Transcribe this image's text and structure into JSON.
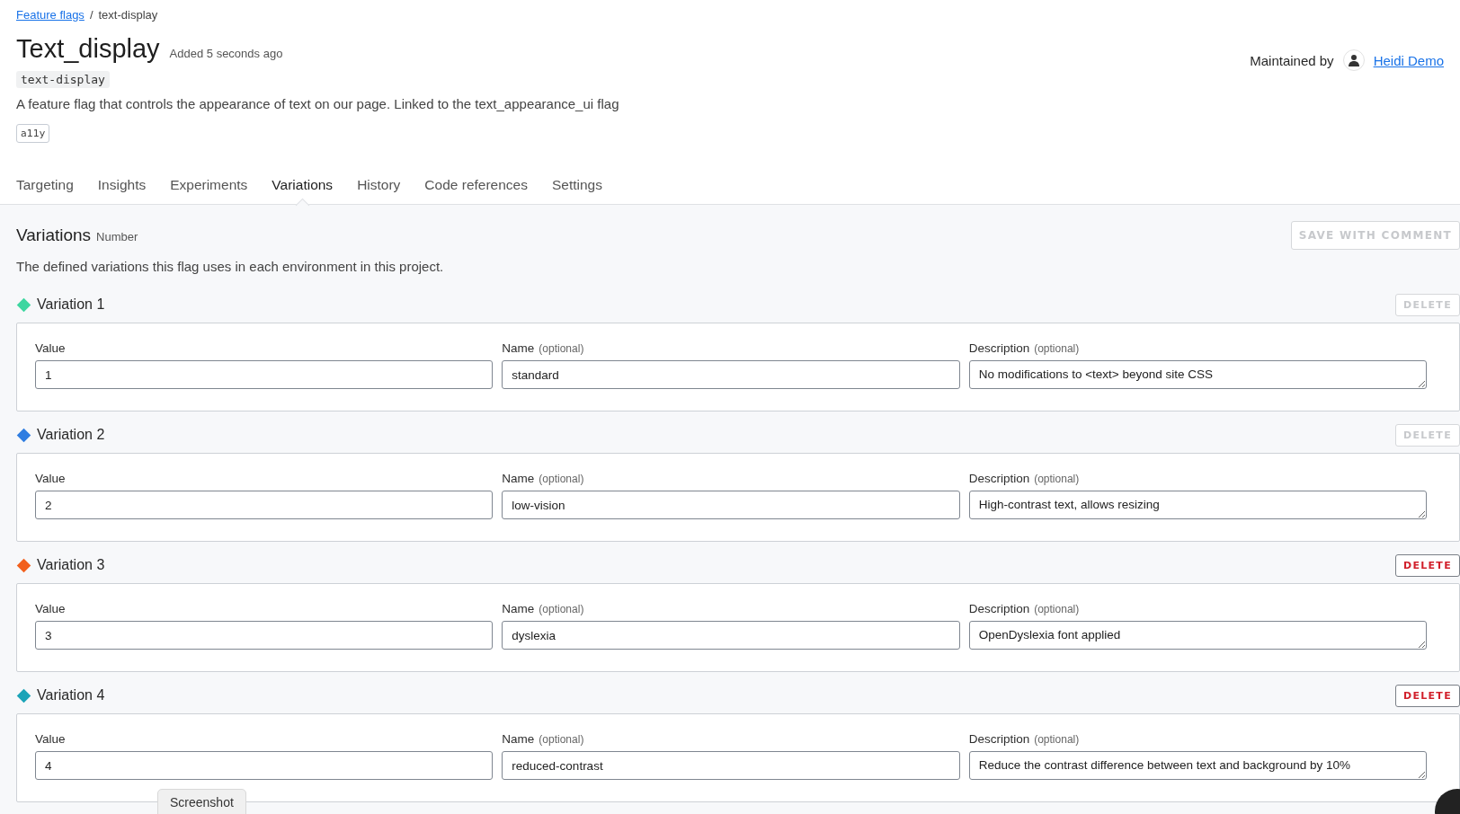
{
  "breadcrumb": {
    "link": "Feature flags",
    "separator": "/",
    "current": "text-display"
  },
  "flag": {
    "title": "Text_display",
    "added": "Added 5 seconds ago",
    "key": "text-display",
    "description": "A feature flag that controls the appearance of text on our page. Linked to the text_appearance_ui flag",
    "tags": [
      "a11y"
    ]
  },
  "maintainer": {
    "label": "Maintained by",
    "name": "Heidi Demo"
  },
  "tabs": [
    {
      "label": "Targeting",
      "selected": false
    },
    {
      "label": "Insights",
      "selected": false
    },
    {
      "label": "Experiments",
      "selected": false
    },
    {
      "label": "Variations",
      "selected": true
    },
    {
      "label": "History",
      "selected": false
    },
    {
      "label": "Code references",
      "selected": false
    },
    {
      "label": "Settings",
      "selected": false
    }
  ],
  "section": {
    "title": "Variations",
    "type": "Number",
    "description": "The defined variations this flag uses in each environment in this project.",
    "save_button": {
      "label": "SAVE WITH COMMENT",
      "disabled": true
    }
  },
  "variations": [
    {
      "title": "Variation 1",
      "color": "#3dd6a0",
      "delete": {
        "label": "DELETE",
        "disabled": true
      },
      "fields": [
        {
          "kind": "input",
          "label": "Value",
          "value": "1"
        },
        {
          "kind": "input",
          "label": "Name",
          "hint": "(optional)",
          "value": "standard"
        },
        {
          "kind": "textarea",
          "label": "Description",
          "hint": "(optional)",
          "value": "No modifications to <text> beyond site CSS"
        }
      ]
    },
    {
      "title": "Variation 2",
      "color": "#2f7de1",
      "delete": {
        "label": "DELETE",
        "disabled": true
      },
      "fields": [
        {
          "kind": "input",
          "label": "Value",
          "value": "2"
        },
        {
          "kind": "input",
          "label": "Name",
          "hint": "(optional)",
          "value": "low-vision"
        },
        {
          "kind": "textarea",
          "label": "Description",
          "hint": "(optional)",
          "value": "High-contrast text, allows resizing"
        }
      ]
    },
    {
      "title": "Variation 3",
      "color": "#f2601d",
      "delete": {
        "label": "DELETE",
        "disabled": false
      },
      "fields": [
        {
          "kind": "input",
          "label": "Value",
          "value": "3"
        },
        {
          "kind": "input",
          "label": "Name",
          "hint": "(optional)",
          "value": "dyslexia"
        },
        {
          "kind": "textarea",
          "label": "Description",
          "hint": "(optional)",
          "value": "OpenDyslexia font applied"
        }
      ]
    },
    {
      "title": "Variation 4",
      "color": "#1ba4b8",
      "delete": {
        "label": "DELETE",
        "disabled": false
      },
      "fields": [
        {
          "kind": "input",
          "label": "Value",
          "value": "4"
        },
        {
          "kind": "input",
          "label": "Name",
          "hint": "(optional)",
          "value": "reduced-contrast"
        },
        {
          "kind": "textarea",
          "label": "Description",
          "hint": "(optional)",
          "value": "Reduce the contrast difference between text and background by 10%"
        }
      ]
    }
  ],
  "overlay_button": {
    "label": "Screenshot"
  }
}
